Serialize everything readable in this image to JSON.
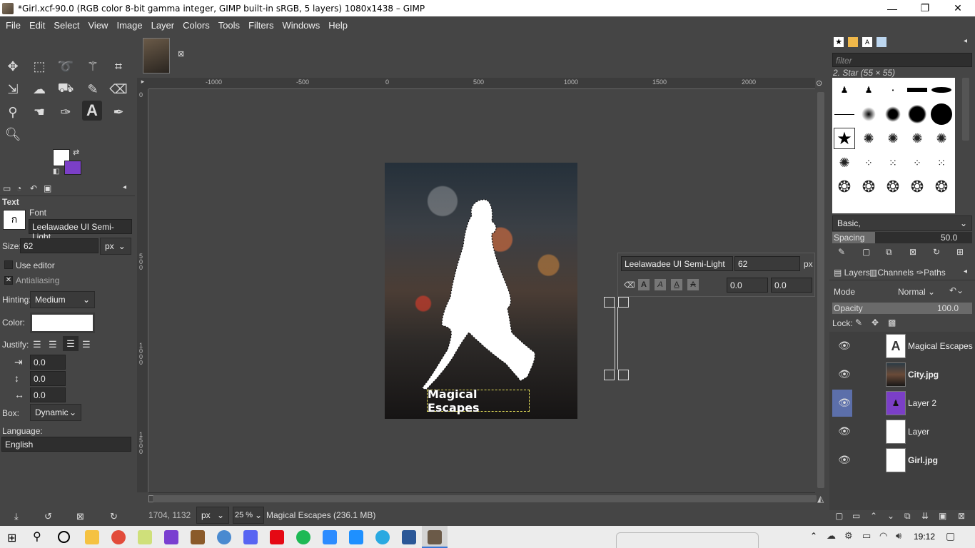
{
  "window": {
    "title": "*Girl.xcf-90.0 (RGB color 8-bit gamma integer, GIMP built-in sRGB, 5 layers) 1080x1438 – GIMP",
    "minimize": "—",
    "maximize": "❐",
    "close": "✕"
  },
  "menu": [
    "File",
    "Edit",
    "Select",
    "View",
    "Image",
    "Layer",
    "Colors",
    "Tools",
    "Filters",
    "Windows",
    "Help"
  ],
  "tool_options": {
    "section": "Text",
    "font_label": "Font",
    "font_value": "Leelawadee UI Semi-Light",
    "size_label": "Size:",
    "size_value": "62",
    "size_unit": "px",
    "use_editor": "Use editor",
    "antialiasing": "Antialiasing",
    "hinting_label": "Hinting:",
    "hinting_value": "Medium",
    "color_label": "Color:",
    "justify_label": "Justify:",
    "indent_value": "0.0",
    "line_spacing_value": "0.0",
    "letter_spacing_value": "0.0",
    "box_label": "Box:",
    "box_value": "Dynamic",
    "language_label": "Language:",
    "language_value": "English"
  },
  "rulers": {
    "top": [
      "-1000",
      "-500",
      "0",
      "500",
      "1000",
      "1500",
      "2000"
    ],
    "left": [
      "0",
      "5\n0\n0",
      "1\n0\n0\n0",
      "1\n5\n0\n0"
    ]
  },
  "canvas": {
    "text_layer": "Magical Escapes"
  },
  "text_toolbar": {
    "font": "Leelawadee UI Semi-Light",
    "size": "62",
    "unit": "px",
    "baseline": "0.0",
    "kerning": "0.0"
  },
  "status": {
    "coords": "1704, 1132",
    "unit": "px",
    "zoom": "25 %",
    "message": "Magical Escapes (236.1 MB)"
  },
  "brushes": {
    "filter_placeholder": "filter",
    "current": "2. Star (55 × 55)",
    "preset": "Basic,",
    "spacing_label": "Spacing",
    "spacing_value": "50.0"
  },
  "layers_panel": {
    "tabs": [
      "Layers",
      "Channels",
      "Paths"
    ],
    "mode_label": "Mode",
    "mode_value": "Normal",
    "opacity_label": "Opacity",
    "opacity_value": "100.0",
    "lock_label": "Lock:",
    "layers": [
      {
        "name": "Magical Escapes",
        "bold": false
      },
      {
        "name": "City.jpg",
        "bold": true
      },
      {
        "name": "Layer 2",
        "bold": false
      },
      {
        "name": "Layer",
        "bold": false
      },
      {
        "name": "Girl.jpg",
        "bold": true
      }
    ]
  },
  "taskbar": {
    "time": "19:12"
  },
  "colors": {
    "foreground": "#ffffff",
    "background": "#7b3fc7",
    "text_box_outline": "#e8e25a",
    "selected_eye": "#5c6faa"
  }
}
